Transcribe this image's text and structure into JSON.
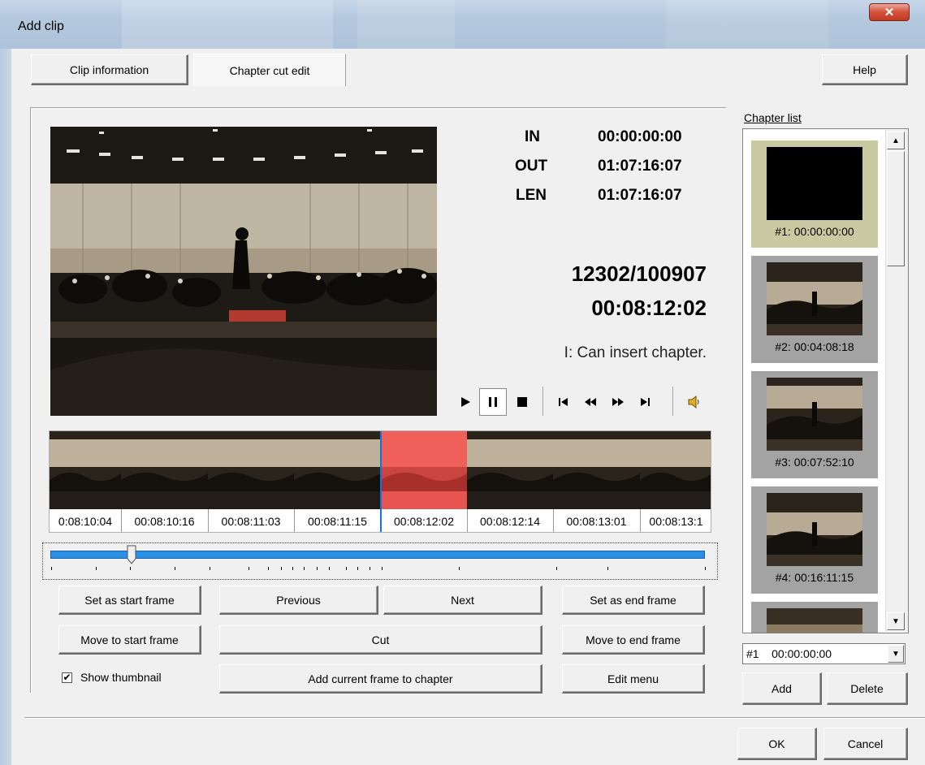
{
  "window": {
    "title": "Add clip",
    "close_glyph": "✕"
  },
  "tabs": {
    "clip_info": "Clip information",
    "chapter_cut": "Chapter cut edit",
    "help": "Help"
  },
  "timecodes": {
    "in_label": "IN",
    "in_value": "00:00:00:00",
    "out_label": "OUT",
    "out_value": "01:07:16:07",
    "len_label": "LEN",
    "len_value": "01:07:16:07",
    "frame_counter": "12302/100907",
    "current_time": "00:08:12:02",
    "status": "I: Can insert chapter."
  },
  "playback": {
    "icons": [
      "play-icon",
      "pause-icon",
      "stop-icon",
      "prev-frame-icon",
      "rewind-icon",
      "fast-forward-icon",
      "next-frame-icon",
      "speaker-icon"
    ]
  },
  "thumbnails": [
    {
      "time": "0:08:10:04",
      "selected": false
    },
    {
      "time": "00:08:10:16",
      "selected": false
    },
    {
      "time": "00:08:11:03",
      "selected": false
    },
    {
      "time": "00:08:11:15",
      "selected": false
    },
    {
      "time": "00:08:12:02",
      "selected": true
    },
    {
      "time": "00:08:12:14",
      "selected": false
    },
    {
      "time": "00:08:13:01",
      "selected": false
    },
    {
      "time": "00:08:13:1",
      "selected": false
    }
  ],
  "buttons": {
    "set_start": "Set as start frame",
    "previous": "Previous",
    "next": "Next",
    "set_end": "Set as end frame",
    "move_start": "Move to start frame",
    "cut": "Cut",
    "move_end": "Move to end frame",
    "add_current": "Add current frame to chapter",
    "edit_menu": "Edit menu",
    "add": "Add",
    "delete": "Delete",
    "ok": "OK",
    "cancel": "Cancel"
  },
  "checkbox": {
    "label": "Show thumbnail",
    "checked": true,
    "mark": "✔"
  },
  "chapter_list": {
    "label": "Chapter list",
    "items": [
      {
        "caption": "#1: 00:00:00:00",
        "selected": true
      },
      {
        "caption": "#2: 00:04:08:18",
        "selected": false
      },
      {
        "caption": "#3: 00:07:52:10",
        "selected": false
      },
      {
        "caption": "#4: 00:16:11:15",
        "selected": false
      }
    ],
    "combo_value": "#1    00:00:00:00"
  },
  "scroll_glyphs": {
    "up": "▲",
    "down": "▼"
  },
  "colors": {
    "accent": "#2b8fe6",
    "selected_thumb": "#f0605a",
    "selected_chapter": "#c9c9a2"
  }
}
